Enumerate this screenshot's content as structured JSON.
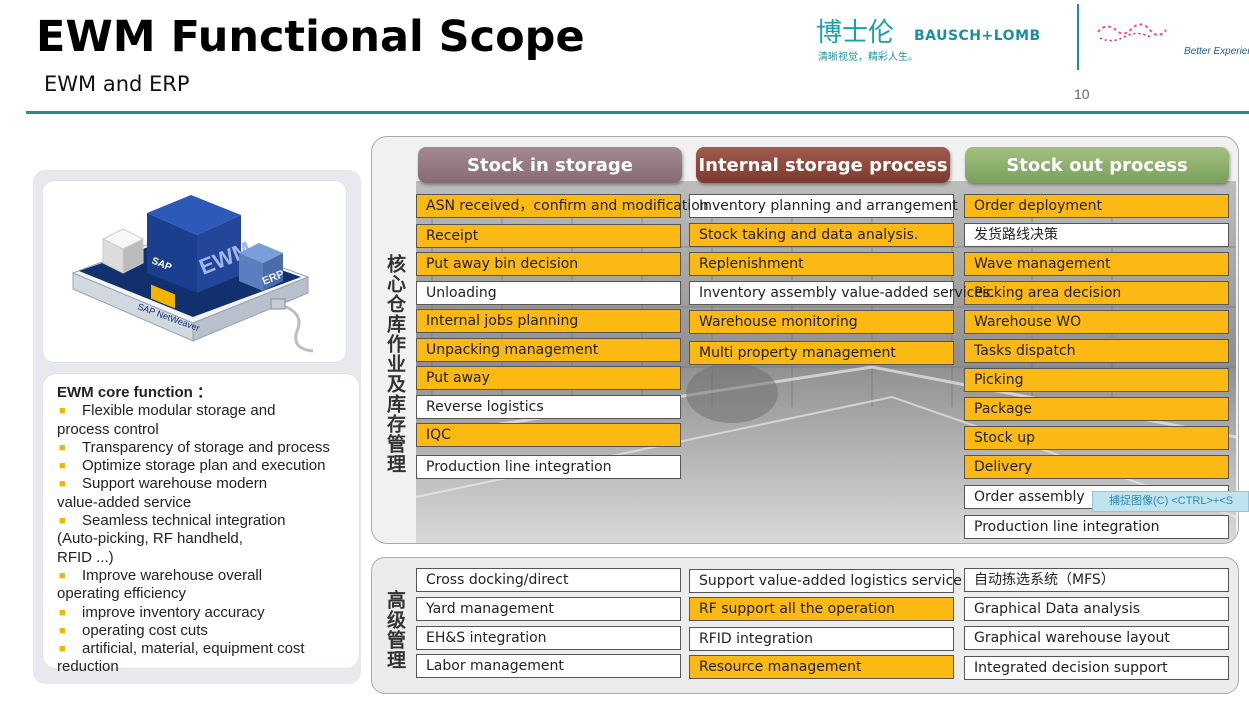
{
  "header": {
    "title": "EWM Functional Scope",
    "subtitle": "EWM and ERP",
    "page_number": "10"
  },
  "logo": {
    "cn_name": "博士伦",
    "brand": "BAUSCH+LOMB",
    "slogan": "清晰视觉，精彩人生。",
    "tagline": "Better Experien"
  },
  "illustration": {
    "cube_label": "EWM",
    "sap_label": "SAP",
    "erp_label": "ERP",
    "base_label": "SAP NetWeaver"
  },
  "core": {
    "title": "EWM core function  ：",
    "items": [
      {
        "text": "Flexible modular storage and",
        "cont": " process control",
        "bullet": true
      },
      {
        "text": "Transparency of storage and process",
        "bullet": true
      },
      {
        "text": "Optimize storage plan and execution",
        "bullet": true
      },
      {
        "text": "Support warehouse modern",
        "cont": "value-added service",
        "bullet": true
      },
      {
        "text": "Seamless technical integration",
        "cont": "(Auto-picking, RF handheld,",
        "cont2": "RFID ...)",
        "bullet": true
      },
      {
        "text": "Improve warehouse overall",
        "cont": "operating efficiency",
        "bullet": true
      },
      {
        "text": "improve inventory accuracy",
        "bullet": true
      },
      {
        "text": "operating cost cuts",
        "bullet": true
      },
      {
        "text": "artificial, material, equipment cost",
        "cont": "reduction",
        "bullet": true
      }
    ]
  },
  "side_labels": {
    "top": "核心仓库作业及库存管理",
    "bottom": "高级管理"
  },
  "columns": {
    "stock_in": {
      "header": "Stock in storage",
      "cells": [
        {
          "text": "ASN received，confirm and modification",
          "highlight": true
        },
        {
          "text": "Receipt",
          "highlight": true
        },
        {
          "text": "Put away bin decision",
          "highlight": true
        },
        {
          "text": "Unloading",
          "highlight": false
        },
        {
          "text": "Internal jobs planning",
          "highlight": true
        },
        {
          "text": "Unpacking management",
          "highlight": true
        },
        {
          "text": "Put away",
          "highlight": true
        },
        {
          "text": "Reverse logistics",
          "highlight": false
        },
        {
          "text": "IQC",
          "highlight": true
        },
        {
          "text": "Production line integration",
          "highlight": false
        }
      ]
    },
    "internal": {
      "header": "Internal storage process",
      "cells": [
        {
          "text": "Inventory planning and arrangement",
          "highlight": false
        },
        {
          "text": "Stock taking and data analysis.",
          "highlight": true
        },
        {
          "text": "Replenishment",
          "highlight": true
        },
        {
          "text": "Inventory assembly value-added services.",
          "highlight": false
        },
        {
          "text": "Warehouse monitoring",
          "highlight": true
        },
        {
          "text": "Multi property management",
          "highlight": true
        }
      ]
    },
    "stock_out": {
      "header": "Stock out process",
      "cells": [
        {
          "text": "Order deployment",
          "highlight": true
        },
        {
          "text": "发货路线决策",
          "highlight": false
        },
        {
          "text": "Wave management",
          "highlight": true
        },
        {
          "text": "Picking area decision",
          "highlight": true
        },
        {
          "text": "Warehouse WO",
          "highlight": true
        },
        {
          "text": "Tasks dispatch",
          "highlight": true
        },
        {
          "text": "Picking",
          "highlight": true
        },
        {
          "text": "Package",
          "highlight": true
        },
        {
          "text": "Stock up",
          "highlight": true
        },
        {
          "text": "Delivery",
          "highlight": true
        },
        {
          "text": "Order assembly",
          "highlight": false
        },
        {
          "text": "Production line integration",
          "highlight": false
        }
      ]
    }
  },
  "advanced": {
    "col1": [
      {
        "text": "Cross  docking/direct",
        "highlight": false
      },
      {
        "text": "Yard management",
        "highlight": false
      },
      {
        "text": "EH&S integration",
        "highlight": false
      },
      {
        "text": "Labor management",
        "highlight": false
      }
    ],
    "col2": [
      {
        "text": "Support value-added logistics service",
        "highlight": false
      },
      {
        "text": "RF support all the operation",
        "highlight": true
      },
      {
        "text": "RFID integration",
        "highlight": false
      },
      {
        "text": "Resource management",
        "highlight": true
      }
    ],
    "col3": [
      {
        "text": "自动拣选系统（MFS）",
        "highlight": false
      },
      {
        "text": "Graphical Data analysis",
        "highlight": false
      },
      {
        "text": "Graphical warehouse layout",
        "highlight": false
      },
      {
        "text": "Integrated decision support",
        "highlight": false
      }
    ]
  },
  "tooltip": {
    "text": "捕捉图像(C)    <CTRL>+<S"
  }
}
